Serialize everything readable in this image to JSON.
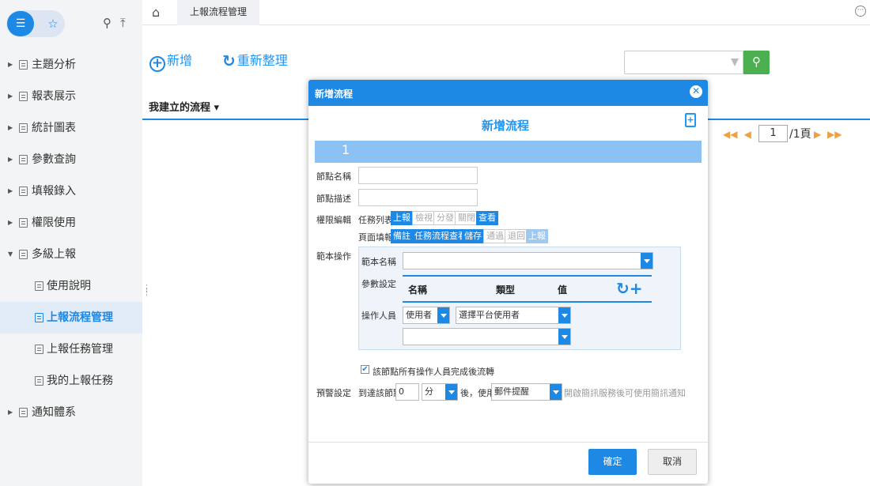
{
  "sidebar": {
    "list_icon": "list-icon",
    "star_icon": "star-icon",
    "search_icon": "search-icon",
    "pin_icon": "pin-icon",
    "items": [
      {
        "label": "主題分析",
        "expanded": false
      },
      {
        "label": "報表展示",
        "expanded": false
      },
      {
        "label": "統計圖表",
        "expanded": false
      },
      {
        "label": "參數查詢",
        "expanded": false
      },
      {
        "label": "填報錄入",
        "expanded": false
      },
      {
        "label": "權限使用",
        "expanded": false
      },
      {
        "label": "多級上報",
        "expanded": true
      },
      {
        "label": "使用說明"
      },
      {
        "label": "上報流程管理",
        "active": true
      },
      {
        "label": "上報任務管理"
      },
      {
        "label": "我的上報任務"
      },
      {
        "label": "通知體系",
        "expanded": false
      }
    ]
  },
  "topbar": {
    "tab_label": "上報流程管理"
  },
  "toolbar": {
    "add_label": "新增",
    "refresh_label": "重新整理",
    "search_value": "",
    "flow_filter": "我建立的流程 ▾"
  },
  "pager": {
    "current_page": "1",
    "total_label": "/1頁"
  },
  "modal": {
    "header_title": "新增流程",
    "title": "新增流程",
    "step_number": "1",
    "labels": {
      "node_name": "節點名稱",
      "node_desc": "節點描述",
      "permission": "權限編輯",
      "task_list": "任務列表",
      "page_fill": "頁面填報",
      "template_op": "範本操作",
      "template_name": "範本名稱",
      "param_setting": "參數設定",
      "operator": "操作人員",
      "warning": "預警設定"
    },
    "task_list_buttons": [
      {
        "label": "上報",
        "state": "on"
      },
      {
        "label": "檢視",
        "state": "off"
      },
      {
        "label": "分發",
        "state": "off"
      },
      {
        "label": "關閉",
        "state": "off"
      },
      {
        "label": "查看",
        "state": "on"
      }
    ],
    "page_fill_buttons": [
      {
        "label": "備註",
        "state": "on"
      },
      {
        "label": "任務流程查看",
        "state": "on"
      },
      {
        "label": "儲存",
        "state": "on"
      },
      {
        "label": "通過",
        "state": "off"
      },
      {
        "label": "退回",
        "state": "off"
      },
      {
        "label": "上報",
        "state": "faded"
      }
    ],
    "param_columns": [
      "名稱",
      "類型",
      "值"
    ],
    "operator_type": "使用者",
    "operator_select": "選擇平台使用者",
    "checkbox_label": "該節點所有操作人員完成後流轉",
    "checkbox_checked": true,
    "warning_prefix": "到達該節點",
    "warning_value": "0",
    "warning_unit": "分",
    "warning_mid": "後，使用",
    "warning_method": "郵件提醒",
    "warning_hint": "開啟簡訊服務後可使用簡訊通知",
    "ok_label": "確定",
    "cancel_label": "取消"
  },
  "colors": {
    "accent": "#1e88e5",
    "search_button": "#4caf50",
    "pager_arrows": "#f0a040",
    "step_bar": "#8cc1f4"
  }
}
